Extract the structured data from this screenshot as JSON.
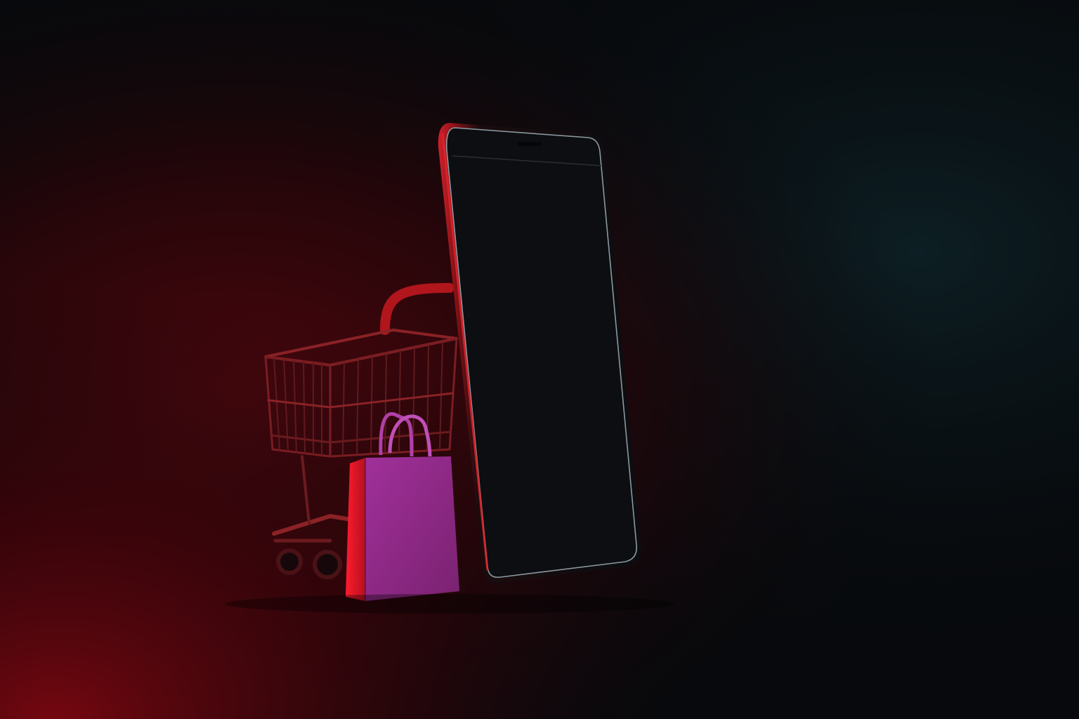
{
  "scene": {
    "objects": [
      "smartphone-icon",
      "shopping-cart-icon",
      "shopping-bag-icon"
    ],
    "colors": {
      "background_dark": "#07090c",
      "background_teal": "#0b1a1e",
      "red_glow": "#b0101a",
      "phone_body": "#0b0d10",
      "phone_frame_red": "#c0181e",
      "phone_edge_highlight": "#9aa8b0",
      "cart_metal": "#8a2226",
      "bag_front": "#8e2a86",
      "bag_side": "#e2152a",
      "bag_handle": "#b040a8"
    }
  }
}
